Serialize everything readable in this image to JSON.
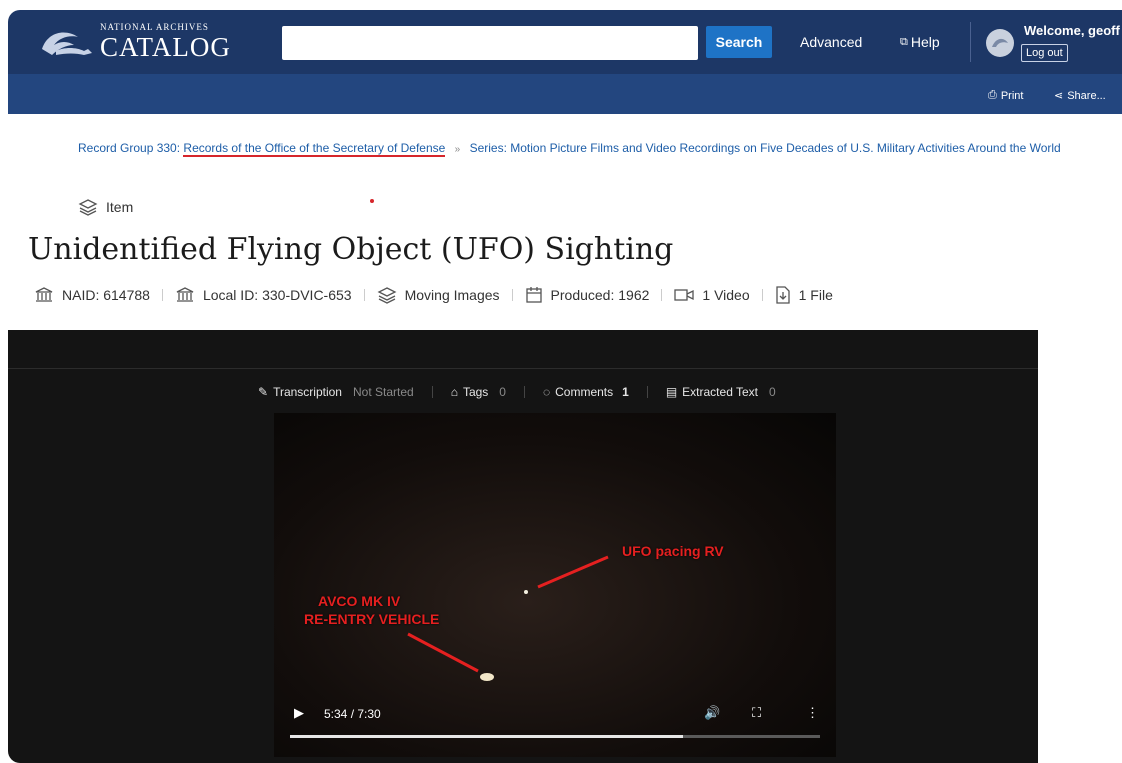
{
  "header": {
    "logo_small": "NATIONAL ARCHIVES",
    "logo_big": "CATALOG",
    "search_placeholder": "",
    "search_button": "Search",
    "advanced": "Advanced",
    "help": "Help",
    "welcome": "Welcome, geoff",
    "logout": "Log out"
  },
  "subbar": {
    "print": "Print",
    "share": "Share..."
  },
  "breadcrumb": {
    "record_group_prefix": "Record Group 330:",
    "record_group_link": "Records of the Office of the Secretary of Defense",
    "separator": "»",
    "series": "Series: Motion Picture Films and Video Recordings on Five Decades of U.S. Military Activities Around the World"
  },
  "item_type": "Item",
  "page_title": "Unidentified Flying Object (UFO) Sighting",
  "meta": {
    "naid": "NAID: 614788",
    "local_id": "Local ID: 330-DVIC-653",
    "media": "Moving Images",
    "produced": "Produced: 1962",
    "video": "1 Video",
    "file": "1 File"
  },
  "viewer_tabs": {
    "transcription": "Transcription",
    "transcription_status": "Not Started",
    "tags": "Tags",
    "tags_count": "0",
    "comments": "Comments",
    "comments_count": "1",
    "extracted": "Extracted Text",
    "extracted_count": "0"
  },
  "video": {
    "caption_ufo": "UFO pacing RV",
    "caption_vehicle_1": "AVCO MK IV",
    "caption_vehicle_2": "RE-ENTRY VEHICLE",
    "time": "5:34 / 7:30",
    "progress_fraction": 0.742
  },
  "colors": {
    "header": "#1d3766",
    "subbar": "#23467f",
    "search": "#1e73c6",
    "caption": "#e52020",
    "underline": "#d6262b"
  }
}
